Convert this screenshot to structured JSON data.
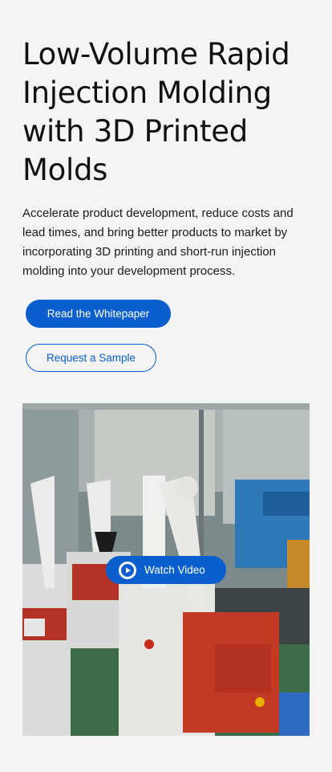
{
  "hero": {
    "title": "Low-Volume Rapid Injection Molding with 3D Printed Molds",
    "description": "Accelerate product development, reduce costs and lead times, and bring better products to market by incorporating 3D printing and short-run injection molding into your development process."
  },
  "actions": {
    "primary_label": "Read the Whitepaper",
    "secondary_label": "Request a Sample"
  },
  "video": {
    "watch_label": "Watch Video",
    "play_icon": "play-icon"
  },
  "colors": {
    "accent": "#0a5ecd",
    "background": "#f4f4f4"
  }
}
